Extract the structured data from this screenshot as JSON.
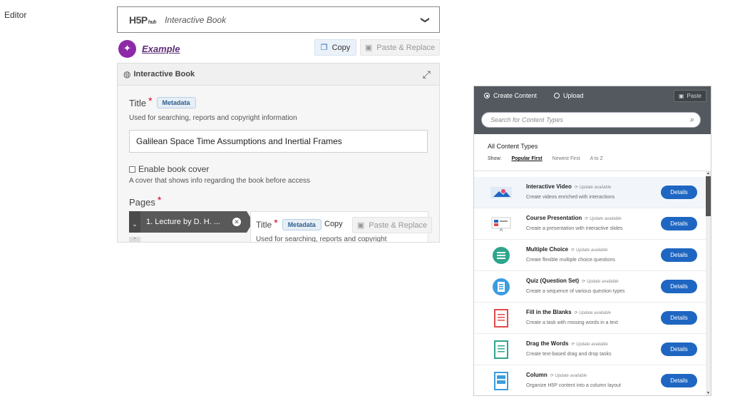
{
  "editor_label": "Editor",
  "hub_bar": {
    "logo": "H5P",
    "logo_sub": "hub",
    "title": "Interactive Book",
    "chevron": "❯"
  },
  "example": {
    "link": "Example",
    "copy_label": "Copy",
    "paste_label": "Paste & Replace"
  },
  "panel": {
    "header": "Interactive Book",
    "title_label": "Title",
    "required_mark": "*",
    "metadata_label": "Metadata",
    "title_desc": "Used for searching, reports and copyright information",
    "title_value": "Galilean Space Time Assumptions and Inertial Frames",
    "cover_label": "Enable book cover",
    "cover_desc": "A cover that shows info regarding the book before access",
    "pages_label": "Pages",
    "chapter_tab": "1. Lecture by D. H. ...",
    "sub_title": "Title",
    "sub_metadata": "Metadata",
    "sub_copy": "Copy",
    "sub_paste": "Paste & Replace",
    "sub_desc": "Used for searching, reports and copyright"
  },
  "hub": {
    "create_label": "Create Content",
    "upload_label": "Upload",
    "paste_label": "Paste",
    "search_placeholder": "Search for Content Types",
    "all_label": "All Content Types",
    "show_label": "Show:",
    "sort_popular": "Popular First",
    "sort_newest": "Newest First",
    "sort_az": "A to Z",
    "update_label": "Update available",
    "details_label": "Details",
    "items": [
      {
        "name": "Interactive Video",
        "desc": "Create videos enriched with interactions",
        "icon": "interactive-video-icon"
      },
      {
        "name": "Course Presentation",
        "desc": "Create a presentation with interactive slides",
        "icon": "course-presentation-icon"
      },
      {
        "name": "Multiple Choice",
        "desc": "Create flexible multiple choice questions",
        "icon": "multiple-choice-icon"
      },
      {
        "name": "Quiz (Question Set)",
        "desc": "Create a sequence of various question types",
        "icon": "question-set-icon"
      },
      {
        "name": "Fill in the Blanks",
        "desc": "Create a task with missing words in a text",
        "icon": "fill-blanks-icon"
      },
      {
        "name": "Drag the Words",
        "desc": "Create text-based drag and drop tasks",
        "icon": "drag-words-icon"
      },
      {
        "name": "Column",
        "desc": "Organize H5P content into a column layout",
        "icon": "column-icon"
      }
    ]
  },
  "colors": {
    "accent": "#1e66c2",
    "example_purple": "#8e2aa8",
    "hub_header": "#53595f",
    "required": "#d0021b"
  }
}
